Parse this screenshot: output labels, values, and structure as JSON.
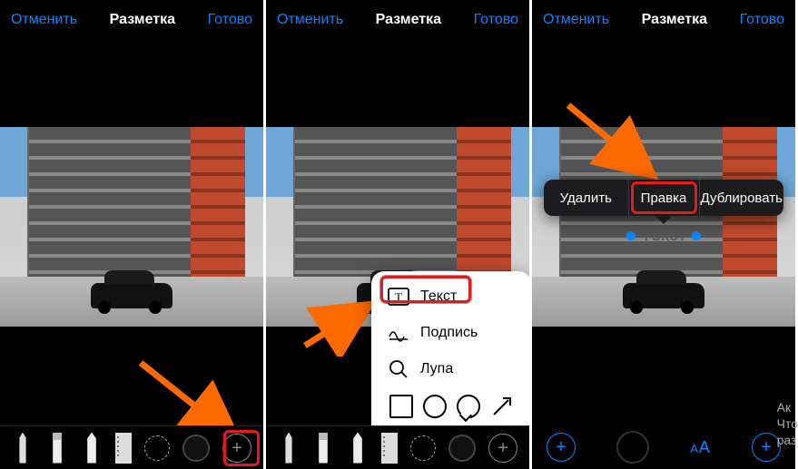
{
  "nav": {
    "cancel": "Отменить",
    "title": "Разметка",
    "done": "Готово"
  },
  "popover": {
    "text": "Текст",
    "signature": "Подпись",
    "magnifier": "Лупа"
  },
  "context_menu": {
    "delete": "Удалить",
    "edit": "Правка",
    "duplicate": "Дублировать"
  },
  "text_object": {
    "placeholder": "Текст"
  },
  "watermark": {
    "l1": "Ак",
    "l2": "Что",
    "l3": "раз"
  }
}
